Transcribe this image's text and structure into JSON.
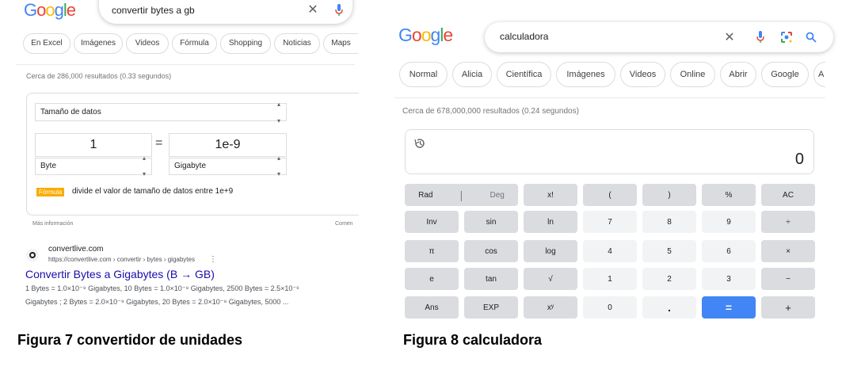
{
  "left": {
    "logo": {
      "letters": [
        "G",
        "o",
        "o",
        "g",
        "l",
        "e"
      ],
      "colors": [
        "#4285f4",
        "#ea4335",
        "#fbbc05",
        "#4285f4",
        "#34a853",
        "#ea4335"
      ]
    },
    "search": {
      "query": "convertir bytes a gb"
    },
    "chips": [
      "En Excel",
      "Imágenes",
      "Videos",
      "Fórmula",
      "Shopping",
      "Noticias",
      "Maps"
    ],
    "result_stats": "Cerca de 286,000 resultados (0.33 segundos)",
    "converter": {
      "category": "Tamaño de datos",
      "from_value": "1",
      "equals": "=",
      "to_value": "1e-9",
      "from_unit": "Byte",
      "to_unit": "Gigabyte",
      "formula_badge": "Fórmula",
      "formula_text": "divide el valor de tamaño de datos entre 1e+9",
      "more_info": "Más información",
      "comments": "Comen"
    },
    "result": {
      "site": "convertlive.com",
      "url": "https://convertlive.com › convertir › bytes › gigabytes",
      "menu": "⋮",
      "title": "Convertir Bytes a Gigabytes (B → GB)",
      "snippet_line1": "1 Bytes = 1.0×10⁻⁹ Gigabytes, 10 Bytes = 1.0×10⁻⁸ Gigabytes, 2500 Bytes = 2.5×10⁻⁶",
      "snippet_line2": "Gigabytes ; 2 Bytes = 2.0×10⁻⁹ Gigabytes, 20 Bytes = 2.0×10⁻⁸ Gigabytes, 5000 ..."
    },
    "caption": "Figura 7 convertidor de unidades"
  },
  "right": {
    "logo": {
      "letters": [
        "G",
        "o",
        "o",
        "g",
        "l",
        "e"
      ],
      "colors": [
        "#4285f4",
        "#ea4335",
        "#fbbc05",
        "#4285f4",
        "#34a853",
        "#ea4335"
      ]
    },
    "search": {
      "query": "calculadora"
    },
    "chips": [
      "Normal",
      "Alicia",
      "Científica",
      "Imágenes",
      "Videos",
      "Online",
      "Abrir",
      "Google",
      "A"
    ],
    "result_stats": "Cerca de 678,000,000 resultados (0.24 segundos)",
    "display": "0",
    "keys": [
      [
        "Rad | Deg",
        "x!",
        "(",
        ")",
        "%",
        "AC"
      ],
      [
        "Inv",
        "sin",
        "ln",
        "7",
        "8",
        "9",
        "÷"
      ],
      [
        "π",
        "cos",
        "log",
        "4",
        "5",
        "6",
        "×"
      ],
      [
        "e",
        "tan",
        "√",
        "1",
        "2",
        "3",
        "−"
      ],
      [
        "Ans",
        "EXP",
        "xʸ",
        "0",
        ".",
        "=",
        "+"
      ]
    ],
    "caption": "Figura 8 calculadora"
  },
  "colors": {
    "link": "#1a0dab",
    "accent": "#4285f4",
    "badge": "#f9ab00"
  }
}
